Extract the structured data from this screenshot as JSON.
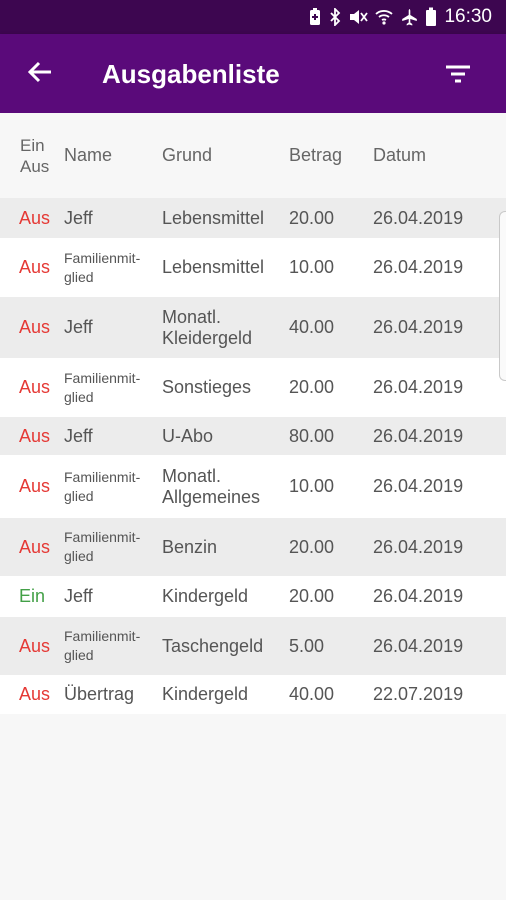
{
  "status_bar": {
    "time": "16:30",
    "icons": [
      "battery-saver-icon",
      "bluetooth-icon",
      "mute-icon",
      "wifi-icon",
      "airplane-icon",
      "battery-icon"
    ]
  },
  "app_bar": {
    "title": "Ausgabenliste",
    "back_icon": "arrow-back-icon",
    "filter_icon": "filter-icon"
  },
  "colors": {
    "app_bar": "#5a0a7a",
    "status_bar": "#3d0650",
    "aus": "#e53935",
    "ein": "#43a047"
  },
  "table": {
    "headers": {
      "type_line1": "Ein",
      "type_line2": "Aus",
      "name": "Name",
      "grund": "Grund",
      "betrag": "Betrag",
      "datum": "Datum"
    },
    "rows": [
      {
        "type": "Aus",
        "name": "Jeff",
        "grund": "Lebensmittel",
        "betrag": "20.00",
        "datum": "26.04.2019"
      },
      {
        "type": "Aus",
        "name": "Familienmit-glied",
        "grund": "Lebensmittel",
        "betrag": "10.00",
        "datum": "26.04.2019"
      },
      {
        "type": "Aus",
        "name": "Jeff",
        "grund": "Monatl. Kleidergeld",
        "betrag": "40.00",
        "datum": "26.04.2019"
      },
      {
        "type": "Aus",
        "name": "Familienmit-glied",
        "grund": "Sonstieges",
        "betrag": "20.00",
        "datum": "26.04.2019"
      },
      {
        "type": "Aus",
        "name": "Jeff",
        "grund": "U-Abo",
        "betrag": "80.00",
        "datum": "26.04.2019"
      },
      {
        "type": "Aus",
        "name": "Familienmit-glied",
        "grund": "Monatl. Allgemeines",
        "betrag": "10.00",
        "datum": "26.04.2019"
      },
      {
        "type": "Aus",
        "name": "Familienmit-glied",
        "grund": "Benzin",
        "betrag": "20.00",
        "datum": "26.04.2019"
      },
      {
        "type": "Ein",
        "name": "Jeff",
        "grund": "Kindergeld",
        "betrag": "20.00",
        "datum": "26.04.2019"
      },
      {
        "type": "Aus",
        "name": "Familienmit-glied",
        "grund": "Taschengeld",
        "betrag": "5.00",
        "datum": "26.04.2019"
      },
      {
        "type": "Aus",
        "name": "Übertrag",
        "grund": "Kindergeld",
        "betrag": "40.00",
        "datum": "22.07.2019"
      }
    ]
  }
}
